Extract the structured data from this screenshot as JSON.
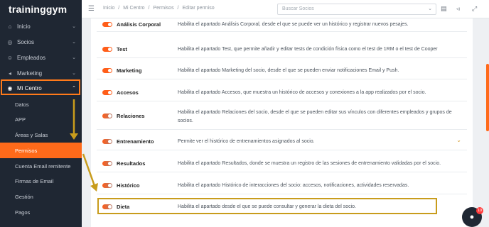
{
  "brand": {
    "name": "traininggym"
  },
  "sidebar": {
    "items": [
      {
        "label": "Inicio",
        "icon": "home-icon"
      },
      {
        "label": "Socios",
        "icon": "users-icon"
      },
      {
        "label": "Empleados",
        "icon": "employees-icon"
      },
      {
        "label": "Marketing",
        "icon": "marketing-icon"
      },
      {
        "label": "Mi Centro",
        "icon": "location-icon"
      }
    ],
    "subitems": [
      {
        "label": "Datos"
      },
      {
        "label": "APP"
      },
      {
        "label": "Áreas y Salas"
      },
      {
        "label": "Permisos"
      },
      {
        "label": "Cuenta Email remitente"
      },
      {
        "label": "Firmas de Email"
      },
      {
        "label": "Gestión"
      },
      {
        "label": "Pagos"
      }
    ]
  },
  "topbar": {
    "breadcrumb": [
      "Inicio",
      "/",
      "Mi Centro",
      "/",
      "Permisos",
      "/",
      "Editar permiso"
    ],
    "search_placeholder": "Buscar Socios"
  },
  "permissions": [
    {
      "name": "Análisis Corporal",
      "desc": "Habilita el apartado Análisis Corporal, desde el que se puede ver un histórico y registrar nuevos pesajes."
    },
    {
      "name": "Test",
      "desc": "Habilita el apartado Test, que permite añadir y editar tests de condición física como el test de 1RM o el test de Cooper"
    },
    {
      "name": "Marketing",
      "desc": "Habilita el apartado Marketing del socio, desde el que se pueden enviar notificaciones Email y Push."
    },
    {
      "name": "Accesos",
      "desc": "Habilita el apartado Accesos, que muestra un histórico de accesos y conexiones a la app realizados por el socio."
    },
    {
      "name": "Relaciones",
      "desc": "Habilita el apartado Relaciones del socio, desde el que se pueden editar sus vínculos con diferentes empleados y grupos de socios."
    },
    {
      "name": "Entrenamiento",
      "desc": "Permite ver el histórico de entrenamientos asignados al socio."
    },
    {
      "name": "Resultados",
      "desc": "Habilita el apartado Resultados, donde se muestra un registro de las sesiones de entrenamiento validadas por el socio."
    },
    {
      "name": "Histórico",
      "desc": "Habilita el apartado Histórico de interacciones del socio: accesos, notificaciones, actividades reservadas."
    },
    {
      "name": "Dieta",
      "desc": "Habilita el apartado desde el que se puede consultar y generar la dieta del socio."
    }
  ],
  "chat": {
    "badge": "10"
  },
  "colors": {
    "accent": "#ff6a1a",
    "sidebar_bg": "#1f2733",
    "highlight_gold": "#c89c1c"
  }
}
